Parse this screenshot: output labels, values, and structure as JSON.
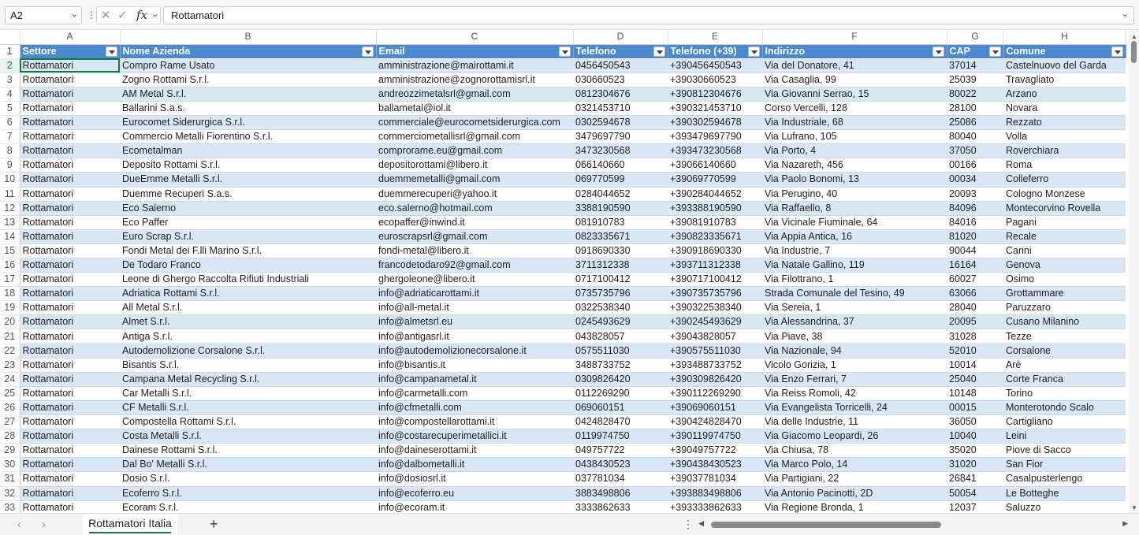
{
  "formula_bar": {
    "name_box": "A2",
    "fx_label": "fx",
    "formula": "Rottamatori"
  },
  "columns": [
    "A",
    "B",
    "C",
    "D",
    "E",
    "F",
    "G",
    "H"
  ],
  "table_headers": [
    "Settore",
    "Nome Azienda",
    "Email",
    "Telefono",
    "Telefono (+39)",
    "Indirizzo",
    "CAP",
    "Comune"
  ],
  "rows": [
    [
      "Rottamatori",
      "Compro Rame Usato",
      "amministrazione@mairottami.it",
      "0456450543",
      "+390456450543",
      "Via del Donatore, 41",
      "37014",
      "Castelnuovo del Garda"
    ],
    [
      "Rottamatori",
      "Zogno Rottami S.r.l.",
      "amministrazione@zognorottamisrl.it",
      "030660523",
      "+39030660523",
      "Via Casaglia, 99",
      "25039",
      "Travagliato"
    ],
    [
      "Rottamatori",
      "AM Metal S.r.l.",
      "andreozzimetalsrl@gmail.com",
      "0812304676",
      "+390812304676",
      "Via Giovanni Serrao, 15",
      "80022",
      "Arzano"
    ],
    [
      "Rottamatori",
      "Ballarini S.a.s.",
      "ballametal@iol.it",
      "0321453710",
      "+390321453710",
      "Corso Vercelli, 128",
      "28100",
      "Novara"
    ],
    [
      "Rottamatori",
      "Eurocomet Siderurgica S.r.l.",
      "commerciale@eurocometsiderurgica.com",
      "0302594678",
      "+390302594678",
      "Via Industriale, 68",
      "25086",
      "Rezzato"
    ],
    [
      "Rottamatori",
      "Commercio Metalli Fiorentino S.r.l.",
      "commerciometallisrl@gmail.com",
      "3479697790",
      "+393479697790",
      "Via Lufrano, 105",
      "80040",
      "Volla"
    ],
    [
      "Rottamatori",
      "Ecometalman",
      "comprorame.eu@gmail.com",
      "3473230568",
      "+393473230568",
      "Via Porto, 4",
      "37050",
      "Roverchiara"
    ],
    [
      "Rottamatori",
      "Deposito Rottami S.r.l.",
      "depositorottami@libero.it",
      "066140660",
      "+39066140660",
      "Via Nazareth, 456",
      "00166",
      "Roma"
    ],
    [
      "Rottamatori",
      "DueEmme Metalli S.r.l.",
      "duemmemetalli@gmail.com",
      "069770599",
      "+39069770599",
      "Via Paolo Bonomi, 13",
      "00034",
      "Colleferro"
    ],
    [
      "Rottamatori",
      "Duemme Recuperi S.a.s.",
      "duemmerecuperi@yahoo.it",
      "0284044652",
      "+390284044652",
      "Via Perugino, 40",
      "20093",
      "Cologno Monzese"
    ],
    [
      "Rottamatori",
      "Eco Salerno",
      "eco.salerno@hotmail.com",
      "3388190590",
      "+393388190590",
      "Via Raffaello, 8",
      "84096",
      "Montecorvino Rovella"
    ],
    [
      "Rottamatori",
      "Eco Paffer",
      "ecopaffer@inwind.it",
      "081910783",
      "+39081910783",
      "Via Vicinale Fiuminale, 64",
      "84016",
      "Pagani"
    ],
    [
      "Rottamatori",
      "Euro Scrap S.r.l.",
      "euroscrapsrl@gmail.com",
      "0823335671",
      "+390823335671",
      "Via Appia Antica, 16",
      "81020",
      "Recale"
    ],
    [
      "Rottamatori",
      "Fondi Metal dei F.lli Marino S.r.l.",
      "fondi-metal@libero.it",
      "0918690330",
      "+390918690330",
      "Via Industrie, 7",
      "90044",
      "Carini"
    ],
    [
      "Rottamatori",
      "De Todaro Franco",
      "francodetodaro92@gmail.com",
      "3711312338",
      "+393711312338",
      "Via Natale Gallino, 119",
      "16164",
      "Genova"
    ],
    [
      "Rottamatori",
      "Leone di Ghergo Raccolta Rifiuti Industriali",
      "ghergoleone@libero.it",
      "0717100412",
      "+390717100412",
      "Via Filottrano, 1",
      "60027",
      "Osimo"
    ],
    [
      "Rottamatori",
      "Adriatica Rottami S.r.l.",
      "info@adriaticarottami.it",
      "0735735796",
      "+390735735796",
      "Strada Comunale del Tesino, 49",
      "63066",
      "Grottammare"
    ],
    [
      "Rottamatori",
      "All Metal S.r.l.",
      "info@all-metal.it",
      "0322538340",
      "+390322538340",
      "Via Sereia, 1",
      "28040",
      "Paruzzaro"
    ],
    [
      "Rottamatori",
      "Almet S.r.l.",
      "info@almetsrl.eu",
      "0245493629",
      "+390245493629",
      "Via Alessandrina, 37",
      "20095",
      "Cusano Milanino"
    ],
    [
      "Rottamatori",
      "Antiga S.r.l.",
      "info@antigasrl.it",
      "043828057",
      "+39043828057",
      "Via Piave, 38",
      "31028",
      "Tezze"
    ],
    [
      "Rottamatori",
      "Autodemolizione Corsalone S.r.l.",
      "info@autodemolizionecorsalone.it",
      "0575511030",
      "+390575511030",
      "Via Nazionale, 94",
      "52010",
      "Corsalone"
    ],
    [
      "Rottamatori",
      "Bisantis S.r.l.",
      "info@bisantis.it",
      "3488733752",
      "+393488733752",
      "Vicolo Gorizia, 1",
      "10014",
      "Arè"
    ],
    [
      "Rottamatori",
      "Campana Metal Recycling S.r.l.",
      "info@campanametal.it",
      "0309826420",
      "+390309826420",
      "Via Enzo Ferrari, 7",
      "25040",
      "Corte Franca"
    ],
    [
      "Rottamatori",
      "Car Metalli S.r.l.",
      "info@carmetalli.com",
      "0112269290",
      "+390112269290",
      "Via Reiss Romoli, 42",
      "10148",
      "Torino"
    ],
    [
      "Rottamatori",
      "CF Metalli S.r.l.",
      "info@cfmetalli.com",
      "069060151",
      "+39069060151",
      "Via Evangelista Torricelli, 24",
      "00015",
      "Monterotondo Scalo"
    ],
    [
      "Rottamatori",
      "Compostella Rottami S.r.l.",
      "info@compostellarottami.it",
      "0424828470",
      "+390424828470",
      "Via delle Industrie, 11",
      "36050",
      "Cartigliano"
    ],
    [
      "Rottamatori",
      "Costa Metalli S.r.l.",
      "info@costarecuperimetallici.it",
      "0119974750",
      "+390119974750",
      "Via Giacomo Leopardi, 26",
      "10040",
      "Leini"
    ],
    [
      "Rottamatori",
      "Dainese Rottami S.r.l.",
      "info@daineserottami.it",
      "049757722",
      "+39049757722",
      "Via Chiusa, 78",
      "35020",
      "Piove di Sacco"
    ],
    [
      "Rottamatori",
      "Dal Bo' Metalli S.r.l.",
      "info@dalbometalli.it",
      "0438430523",
      "+390438430523",
      "Via Marco Polo, 14",
      "31020",
      "San Fior"
    ],
    [
      "Rottamatori",
      "Dosio S.r.l.",
      "info@dosiosrl.it",
      "037781034",
      "+39037781034",
      "Via Partigiani, 22",
      "26841",
      "Casalpusterlengo"
    ],
    [
      "Rottamatori",
      "Ecoferro S.r.l.",
      "info@ecoferro.eu",
      "3883498806",
      "+393883498806",
      "Via Antonio Pacinotti, 2D",
      "50054",
      "Le Botteghe"
    ],
    [
      "Rottamatori",
      "Ecoram S.r.l.",
      "info@ecoram.it",
      "3333862633",
      "+393333862633",
      "Via Regione Bronda, 1",
      "12037",
      "Saluzzo"
    ]
  ],
  "sheet_tabs": [
    "Rottamatori Italia"
  ],
  "icons": {
    "cancel": "close-icon",
    "confirm": "check-icon",
    "function": "fx-icon",
    "add_sheet": "plus-icon",
    "filter": "filter-dropdown-icon"
  },
  "colors": {
    "header_fill": "#4a89d0",
    "band_fill": "#d9e6f5",
    "accent": "#107c41"
  }
}
